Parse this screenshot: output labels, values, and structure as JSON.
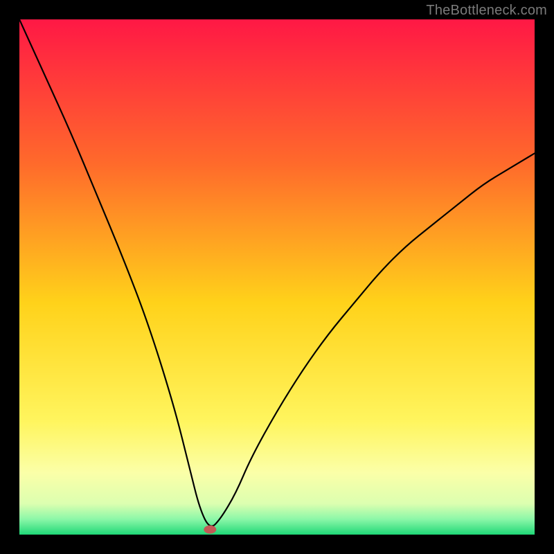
{
  "watermark": "TheBottleneck.com",
  "chart_data": {
    "type": "line",
    "title": "",
    "xlabel": "",
    "ylabel": "",
    "xlim": [
      0,
      100
    ],
    "ylim": [
      0,
      100
    ],
    "grid": false,
    "legend": false,
    "gradient_stops": [
      {
        "offset": 0.0,
        "color": "#ff1845"
      },
      {
        "offset": 0.28,
        "color": "#ff6a2b"
      },
      {
        "offset": 0.55,
        "color": "#ffd21a"
      },
      {
        "offset": 0.78,
        "color": "#fff55e"
      },
      {
        "offset": 0.88,
        "color": "#fbffa8"
      },
      {
        "offset": 0.94,
        "color": "#dcffb0"
      },
      {
        "offset": 0.97,
        "color": "#8cf7a8"
      },
      {
        "offset": 1.0,
        "color": "#1fd877"
      }
    ],
    "curve": {
      "description": "V-shaped bottleneck curve; minimum (best) at x≈37",
      "x": [
        0,
        5,
        10,
        15,
        20,
        25,
        30,
        33,
        35,
        37,
        39,
        42,
        45,
        50,
        55,
        60,
        65,
        70,
        75,
        80,
        85,
        90,
        95,
        100
      ],
      "y": [
        100,
        89,
        78,
        66,
        54,
        41,
        25,
        13,
        5,
        1,
        3,
        8,
        15,
        24,
        32,
        39,
        45,
        51,
        56,
        60,
        64,
        68,
        71,
        74
      ]
    },
    "marker": {
      "x": 37,
      "y": 1,
      "color": "#c25a56",
      "rx": 9,
      "ry": 6
    }
  }
}
